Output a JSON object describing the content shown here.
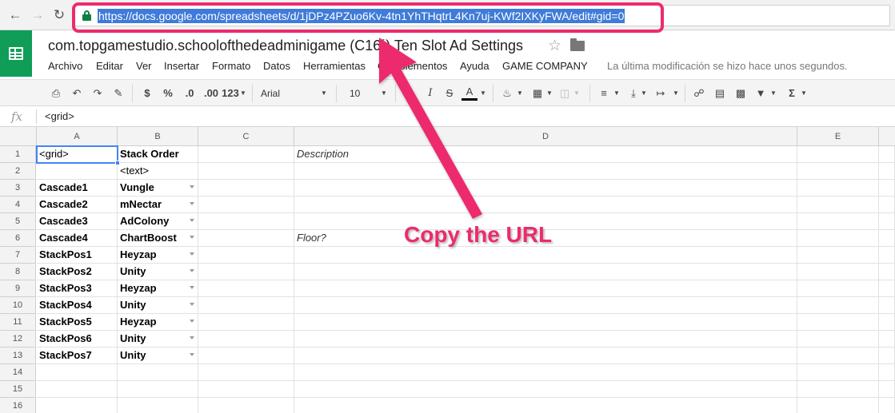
{
  "browser": {
    "back_icon": "back-arrow-icon",
    "forward_icon": "forward-arrow-icon",
    "reload_icon": "reload-icon",
    "lock_icon": "lock-icon",
    "url": "https://docs.google.com/spreadsheets/d/1jDPz4PZuo6Kv-4tn1YhTHqtrL4Kn7uj-KWf2IXKyFWA/edit#gid=0"
  },
  "doc": {
    "title": "com.topgamestudio.schoolofthedeadminigame (C16´) Ten Slot Ad Settings",
    "menu": [
      "Archivo",
      "Editar",
      "Ver",
      "Insertar",
      "Formato",
      "Datos",
      "Herramientas",
      "Complementos",
      "Ayuda",
      "GAME COMPANY"
    ],
    "last_modified": "La última modificación se hizo hace unos segundos."
  },
  "toolbar": {
    "currency": "$",
    "percent": "%",
    "decimal_less": ".0",
    "decimal_more": ".00",
    "more_formats": "123",
    "font": "Arial",
    "font_size": "10",
    "bold": "B",
    "italic": "I",
    "strike": "S",
    "text_color": "A",
    "sum": "Σ"
  },
  "formula_bar": {
    "label": "fx",
    "value": "<grid>"
  },
  "sheet": {
    "columns": [
      "A",
      "B",
      "C",
      "D",
      "E"
    ],
    "rows": [
      {
        "num": "1",
        "a": "<grid>",
        "b": "Stack Order",
        "d": "Description",
        "b_dropdown": false
      },
      {
        "num": "2",
        "a": "",
        "b": "<text>",
        "d": "",
        "b_dropdown": false
      },
      {
        "num": "3",
        "a": "Cascade1",
        "b": "Vungle",
        "d": "",
        "b_dropdown": true
      },
      {
        "num": "4",
        "a": "Cascade2",
        "b": "mNectar",
        "d": "",
        "b_dropdown": true
      },
      {
        "num": "5",
        "a": "Cascade3",
        "b": "AdColony",
        "d": "",
        "b_dropdown": true
      },
      {
        "num": "6",
        "a": "Cascade4",
        "b": "ChartBoost",
        "d": "Floor?",
        "b_dropdown": true
      },
      {
        "num": "7",
        "a": "StackPos1",
        "b": "Heyzap",
        "d": "",
        "b_dropdown": true
      },
      {
        "num": "8",
        "a": "StackPos2",
        "b": "Unity",
        "d": "",
        "b_dropdown": true
      },
      {
        "num": "9",
        "a": "StackPos3",
        "b": "Heyzap",
        "d": "",
        "b_dropdown": true
      },
      {
        "num": "10",
        "a": "StackPos4",
        "b": "Unity",
        "d": "",
        "b_dropdown": true
      },
      {
        "num": "11",
        "a": "StackPos5",
        "b": "Heyzap",
        "d": "",
        "b_dropdown": true
      },
      {
        "num": "12",
        "a": "StackPos6",
        "b": "Unity",
        "d": "",
        "b_dropdown": true
      },
      {
        "num": "13",
        "a": "StackPos7",
        "b": "Unity",
        "d": "",
        "b_dropdown": true
      },
      {
        "num": "14",
        "a": "",
        "b": "",
        "d": "",
        "b_dropdown": false
      },
      {
        "num": "15",
        "a": "",
        "b": "",
        "d": "",
        "b_dropdown": false
      },
      {
        "num": "16",
        "a": "",
        "b": "",
        "d": "",
        "b_dropdown": false
      }
    ]
  },
  "annotation": {
    "callout": "Copy the URL"
  },
  "colors": {
    "accent": "#ec2b6d",
    "sheets_green": "#0f9d58",
    "selection_blue": "#4285f4",
    "url_highlight": "#3f7bd8"
  }
}
